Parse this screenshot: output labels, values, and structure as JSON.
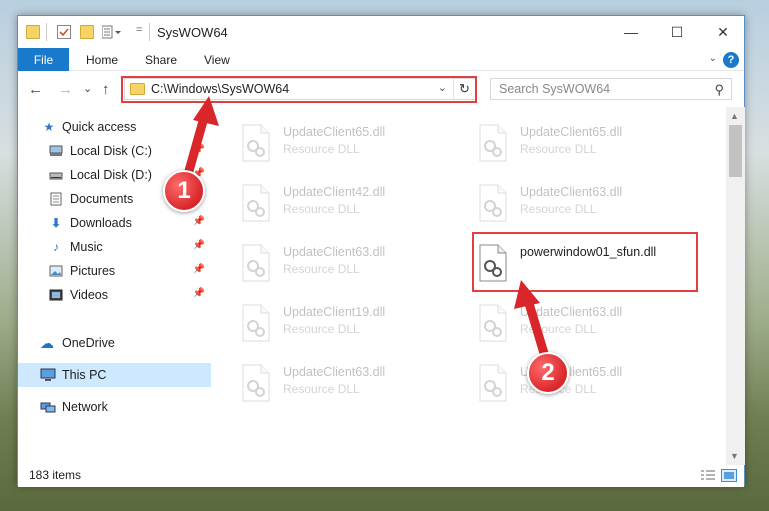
{
  "window": {
    "title": "SysWOW64",
    "min_label": "—",
    "max_label": "☐",
    "close_label": "✕"
  },
  "ribbon": {
    "file_tab": "File",
    "tabs": [
      "Home",
      "Share",
      "View"
    ],
    "help_label": "?"
  },
  "nav": {
    "back": "←",
    "forward": "→",
    "recent": "⌄",
    "up": "↑"
  },
  "address": {
    "path": "C:\\Windows\\SysWOW64",
    "chevron": "⌄",
    "refresh": "↻"
  },
  "search": {
    "placeholder": "Search SysWOW64",
    "icon": "⚲"
  },
  "sidebar": {
    "items": [
      {
        "label": "Quick access",
        "icon": "star-icon",
        "pinned": false
      },
      {
        "label": "Local Disk (C:)",
        "icon": "drive-icon",
        "pinned": true
      },
      {
        "label": "Local Disk (D:)",
        "icon": "drive-icon",
        "pinned": true
      },
      {
        "label": "Documents",
        "icon": "documents-icon",
        "pinned": true
      },
      {
        "label": "Downloads",
        "icon": "download-icon",
        "pinned": true
      },
      {
        "label": "Music",
        "icon": "music-icon",
        "pinned": true
      },
      {
        "label": "Pictures",
        "icon": "pictures-icon",
        "pinned": true
      },
      {
        "label": "Videos",
        "icon": "videos-icon",
        "pinned": true
      },
      {
        "label": "OneDrive",
        "icon": "cloud-icon",
        "pinned": false
      },
      {
        "label": "This PC",
        "icon": "computer-icon",
        "pinned": false,
        "selected": true
      },
      {
        "label": "Network",
        "icon": "network-icon",
        "pinned": false
      }
    ]
  },
  "files": [
    {
      "name": "UpdateClient65.dll",
      "type": "Resource DLL"
    },
    {
      "name": "UpdateClient65.dll",
      "type": "Resource DLL"
    },
    {
      "name": "UpdateClient42.dll",
      "type": "Resource DLL"
    },
    {
      "name": "UpdateClient63.dll",
      "type": "Resource DLL"
    },
    {
      "name": "UpdateClient63.dll",
      "type": "Resource DLL"
    },
    {
      "name": "powerwindow01_sfun.dll",
      "type": "",
      "highlighted": true
    },
    {
      "name": "UpdateClient19.dll",
      "type": "Resource DLL"
    },
    {
      "name": "UpdateClient63.dll",
      "type": "Resource DLL"
    },
    {
      "name": "UpdateClient63.dll",
      "type": "Resource DLL"
    },
    {
      "name": "UpdateClient65.dll",
      "type": "Resource DLL"
    }
  ],
  "status": {
    "item_count": "183 items"
  },
  "annotations": {
    "step1": "1",
    "step2": "2",
    "color": "#e04040"
  },
  "colors": {
    "accent": "#1979ca",
    "selection": "#cde8ff",
    "annotation": "#e04040"
  }
}
